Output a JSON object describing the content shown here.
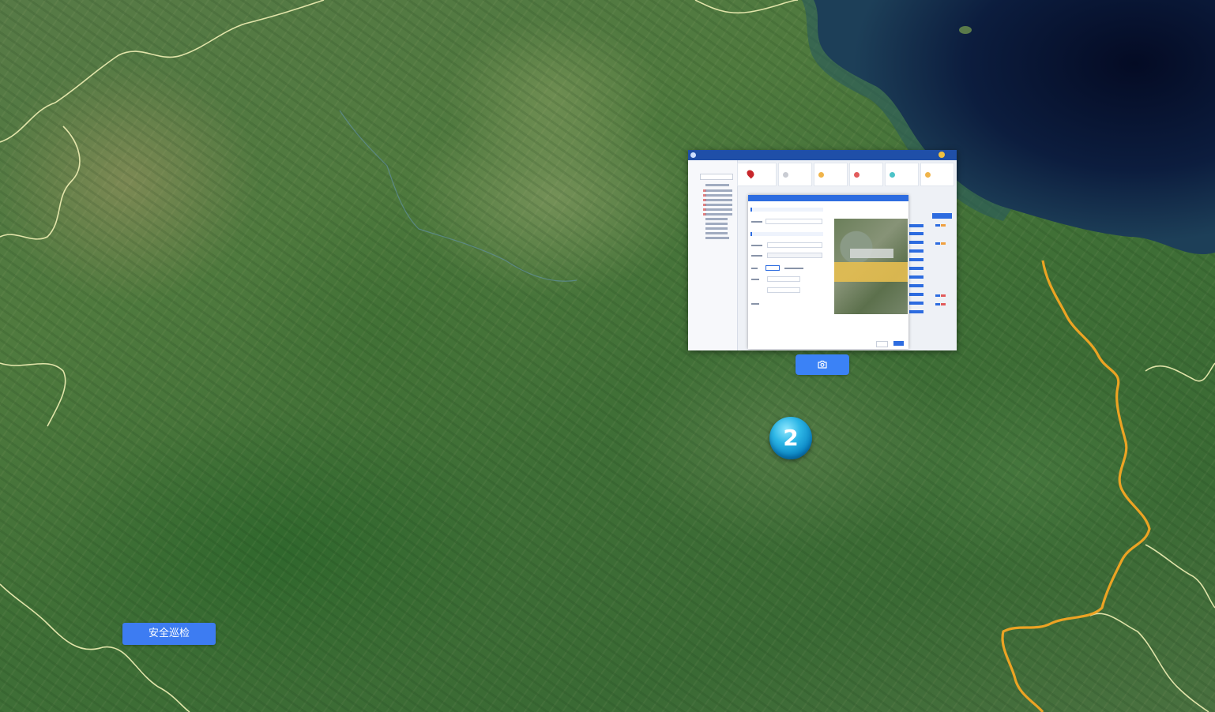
{
  "map": {
    "background": "satellite-imagery",
    "colors": {
      "province_border": "#f2f1b6",
      "highlight_border": "#f5a623",
      "sea_deep": "#0a1530",
      "land": "#4f7a3e"
    }
  },
  "screenshot_preview": {
    "icon": "screenshot-thumbnail"
  },
  "camera_button": {
    "icon": "camera-icon",
    "color": "#3b82f6"
  },
  "cluster_marker": {
    "count": "2",
    "color": "#1aa6dc"
  },
  "patrol_button": {
    "label": "安全巡检",
    "color": "#3d7cf2"
  }
}
